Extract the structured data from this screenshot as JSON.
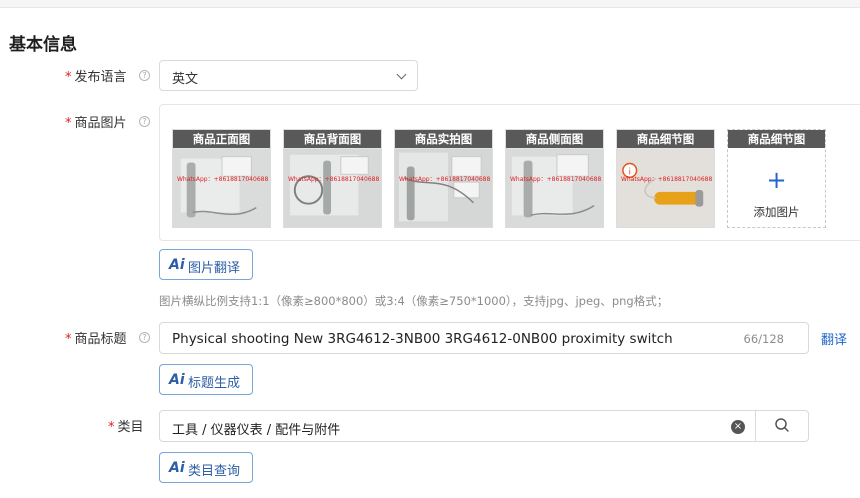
{
  "section_title": "基本信息",
  "language": {
    "label": "发布语言",
    "required_mark": "*",
    "help_icon": "question-circle-icon",
    "value": "英文",
    "dropdown_icon": "chevron-down-icon"
  },
  "images": {
    "label": "商品图片",
    "required_mark": "*",
    "help_icon": "question-circle-icon",
    "thumbnails": [
      {
        "caption": "商品正面图",
        "watermark": "WhatsApp：+8618817040688"
      },
      {
        "caption": "商品背面图",
        "watermark": "WhatsApp：+8618817040688"
      },
      {
        "caption": "商品实拍图",
        "watermark": "WhatsApp：+8618817040688"
      },
      {
        "caption": "商品侧面图",
        "watermark": "WhatsApp：+8618817040688"
      },
      {
        "caption": "商品细节图",
        "watermark": "WhatsApp：+8618817040688"
      }
    ],
    "add_slot": {
      "caption": "商品细节图",
      "plus": "+",
      "label": "添加图片"
    },
    "translate_button": "图片翻译",
    "ai_icon_text": "Ai",
    "hint": "图片横纵比例支持1:1（像素≥800*800）或3:4（像素≥750*1000），支持jpg、jpeg、png格式；"
  },
  "title": {
    "label": "商品标题",
    "required_mark": "*",
    "help_icon": "question-circle-icon",
    "value": "Physical shooting New 3RG4612-3NB00 3RG4612-0NB00 proximity switch",
    "counter": "66/128",
    "translate_link": "翻译",
    "generate_button": "标题生成",
    "ai_icon_text": "Ai"
  },
  "category": {
    "label": "类目",
    "required_mark": "*",
    "value": "工具 / 仪器仪表 / 配件与附件",
    "clear_icon": "close-circle-icon",
    "search_icon": "search-icon",
    "query_button": "类目查询",
    "ai_icon_text": "Ai"
  },
  "colors": {
    "accent": "#2266cc",
    "required": "#e0201b",
    "caption_bg": "#595959"
  }
}
